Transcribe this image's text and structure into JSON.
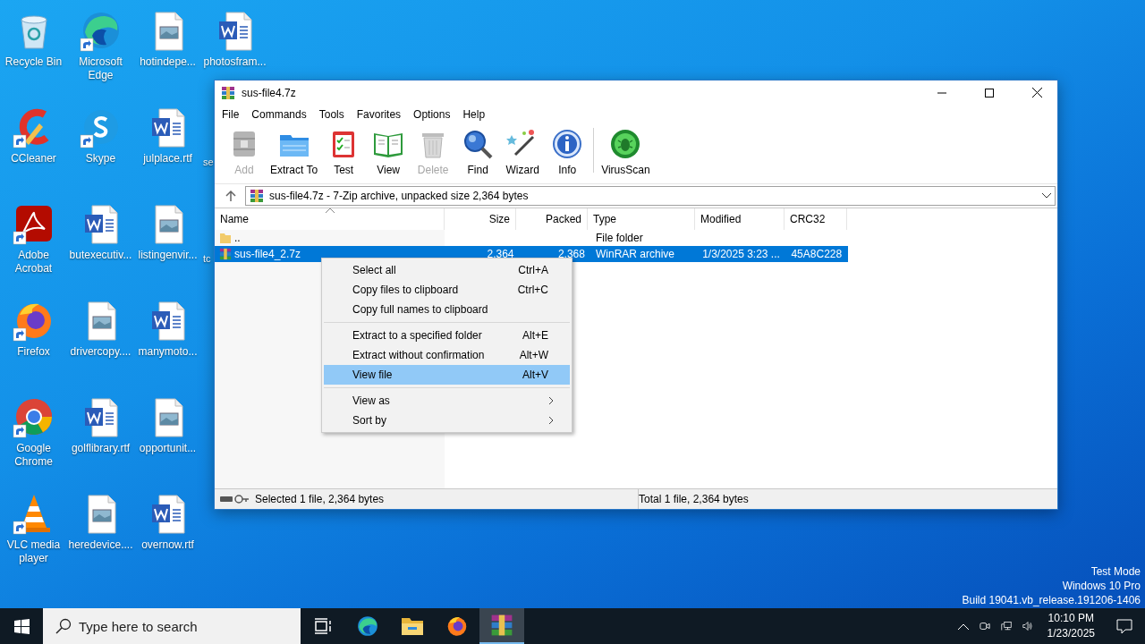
{
  "desktop": {
    "columns": [
      {
        "icons": [
          {
            "label": "Recycle Bin",
            "kind": "recycle",
            "shortcut": false
          },
          {
            "label": "CCleaner",
            "kind": "ccleaner",
            "shortcut": true
          },
          {
            "label": "Adobe Acrobat",
            "kind": "acrobat",
            "shortcut": true
          },
          {
            "label": "Firefox",
            "kind": "firefox",
            "shortcut": true
          },
          {
            "label": "Google Chrome",
            "kind": "chrome",
            "shortcut": true
          },
          {
            "label": "VLC media player",
            "kind": "vlc",
            "shortcut": true
          }
        ]
      },
      {
        "icons": [
          {
            "label": "Microsoft Edge",
            "kind": "edge",
            "shortcut": true
          },
          {
            "label": "Skype",
            "kind": "skype",
            "shortcut": true
          },
          {
            "label": "butexecutiv...",
            "kind": "word",
            "shortcut": false
          },
          {
            "label": "drivercopy....",
            "kind": "image",
            "shortcut": false
          },
          {
            "label": "golflibrary.rtf",
            "kind": "word",
            "shortcut": false
          },
          {
            "label": "heredevice....",
            "kind": "image",
            "shortcut": false
          }
        ]
      },
      {
        "icons": [
          {
            "label": "hotindepe...",
            "kind": "image",
            "shortcut": false
          },
          {
            "label": "julplace.rtf",
            "kind": "word",
            "shortcut": false
          },
          {
            "label": "listingenvir...",
            "kind": "image",
            "shortcut": false
          },
          {
            "label": "manymoto...",
            "kind": "word",
            "shortcut": false
          },
          {
            "label": "opportunit...",
            "kind": "image",
            "shortcut": false
          },
          {
            "label": "overnow.rtf",
            "kind": "word",
            "shortcut": false
          }
        ]
      },
      {
        "icons": [
          {
            "label": "photosfram...",
            "kind": "word",
            "shortcut": false
          },
          {
            "label": "se",
            "kind": "covered"
          },
          {
            "label": "tc",
            "kind": "covered"
          }
        ]
      }
    ],
    "system_notice": [
      "Test Mode",
      "Windows 10 Pro",
      "Build 19041.vb_release.191206-1406"
    ]
  },
  "window": {
    "title": "sus-file4.7z",
    "menu": [
      "File",
      "Commands",
      "Tools",
      "Favorites",
      "Options",
      "Help"
    ],
    "toolbar": [
      {
        "label": "Add",
        "kind": "add",
        "disabled": true
      },
      {
        "label": "Extract To",
        "kind": "extract",
        "disabled": false
      },
      {
        "label": "Test",
        "kind": "test",
        "disabled": false
      },
      {
        "label": "View",
        "kind": "view",
        "disabled": false
      },
      {
        "label": "Delete",
        "kind": "delete",
        "disabled": true
      },
      {
        "label": "Find",
        "kind": "find",
        "disabled": false
      },
      {
        "label": "Wizard",
        "kind": "wizard",
        "disabled": false
      },
      {
        "label": "Info",
        "kind": "info",
        "disabled": false
      },
      {
        "label": "VirusScan",
        "kind": "virus",
        "disabled": false
      }
    ],
    "address": "sus-file4.7z - 7-Zip archive, unpacked size 2,364 bytes",
    "columns": [
      "Name",
      "Size",
      "Packed",
      "Type",
      "Modified",
      "CRC32"
    ],
    "rows": [
      {
        "kind": "folder",
        "cells": [
          "..",
          "",
          "",
          "File folder",
          "",
          ""
        ],
        "selected": false
      },
      {
        "kind": "archive",
        "cells": [
          "sus-file4_2.7z",
          "2,364",
          "2,368",
          "WinRAR archive",
          "1/3/2025 3:23 ...",
          "45A8C228"
        ],
        "selected": true
      }
    ],
    "status_left": "Selected 1 file, 2,364 bytes",
    "status_right": "Total 1 file, 2,364 bytes"
  },
  "context_menu": {
    "groups": [
      {
        "items": [
          {
            "label": "Select all",
            "shortcut": "Ctrl+A",
            "selected": false,
            "submenu": false
          },
          {
            "label": "Copy files to clipboard",
            "shortcut": "Ctrl+C",
            "selected": false,
            "submenu": false
          },
          {
            "label": "Copy full names to clipboard",
            "selected": false,
            "submenu": false
          }
        ]
      },
      {
        "items": [
          {
            "label": "Extract to a specified folder",
            "shortcut": "Alt+E",
            "selected": false,
            "submenu": false
          },
          {
            "label": "Extract without confirmation",
            "shortcut": "Alt+W",
            "selected": false,
            "submenu": false
          },
          {
            "label": "View file",
            "shortcut": "Alt+V",
            "selected": true,
            "submenu": false
          }
        ]
      },
      {
        "items": [
          {
            "label": "View as",
            "selected": false,
            "submenu": true
          },
          {
            "label": "Sort by",
            "selected": false,
            "submenu": true
          }
        ]
      }
    ]
  },
  "taskbar": {
    "search_placeholder": "Type here to search",
    "apps": [
      {
        "kind": "taskview",
        "active": false
      },
      {
        "kind": "edge",
        "active": false
      },
      {
        "kind": "explorer",
        "active": false
      },
      {
        "kind": "firefox",
        "active": false
      },
      {
        "kind": "winrar",
        "active": true
      }
    ],
    "time": "10:10 PM",
    "date": "1/23/2025"
  }
}
